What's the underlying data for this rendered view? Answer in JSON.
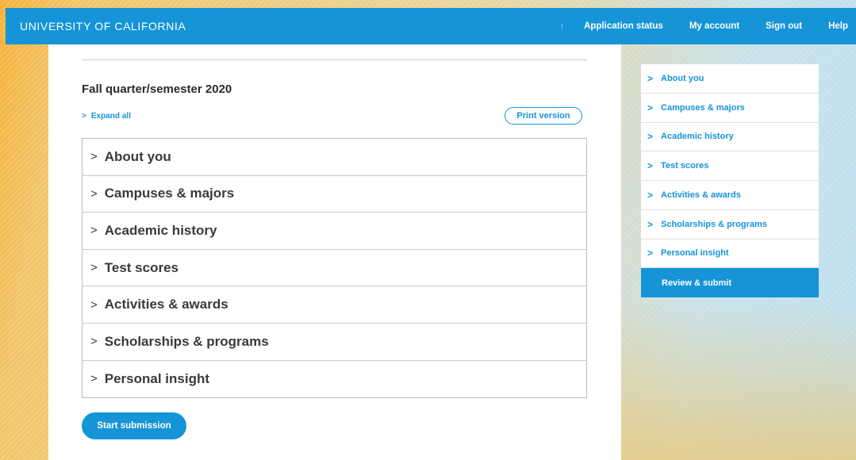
{
  "header": {
    "brand": "UNIVERSITY OF CALIFORNIA",
    "nav": [
      "Application status",
      "My account",
      "Sign out",
      "Help"
    ]
  },
  "main": {
    "term": "Fall quarter/semester 2020",
    "expand_all": "Expand all",
    "print_version": "Print version",
    "sections": [
      "About you",
      "Campuses & majors",
      "Academic history",
      "Test scores",
      "Activities & awards",
      "Scholarships & programs",
      "Personal insight"
    ],
    "start_submission": "Start submission"
  },
  "sidebar": {
    "items": [
      "About you",
      "Campuses & majors",
      "Academic history",
      "Test scores",
      "Activities & awards",
      "Scholarships & programs",
      "Personal insight",
      "Review & submit"
    ],
    "active_item": "Review & submit"
  },
  "icons": {
    "chevron": "chevron-right-icon"
  },
  "colors": {
    "accent": "#1594d8",
    "text": "#3a3a3a"
  }
}
